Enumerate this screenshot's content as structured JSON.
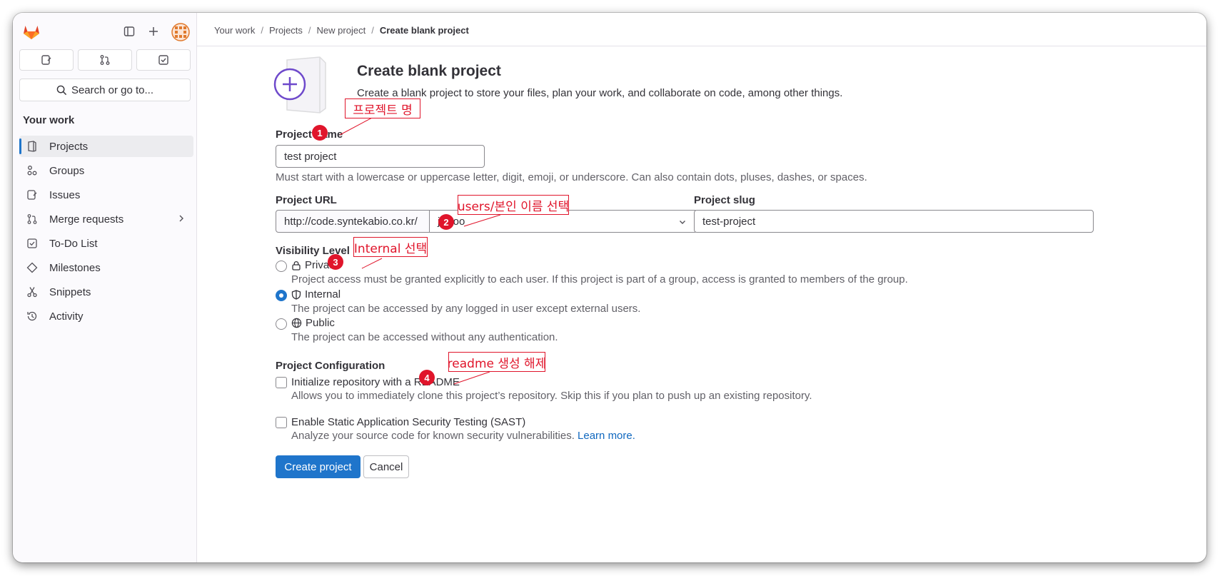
{
  "sidebar": {
    "section_title": "Your work",
    "search_label": "Search or go to...",
    "quick_actions": [
      "issues-icon",
      "merge-request-icon",
      "todo-icon"
    ],
    "items": [
      {
        "label": "Projects",
        "icon": "project-icon",
        "active": true
      },
      {
        "label": "Groups",
        "icon": "group-icon"
      },
      {
        "label": "Issues",
        "icon": "issues-icon"
      },
      {
        "label": "Merge requests",
        "icon": "merge-request-icon",
        "has_chevron": true
      },
      {
        "label": "To-Do List",
        "icon": "todo-icon"
      },
      {
        "label": "Milestones",
        "icon": "milestone-icon"
      },
      {
        "label": "Snippets",
        "icon": "snippet-icon"
      },
      {
        "label": "Activity",
        "icon": "history-icon"
      }
    ]
  },
  "breadcrumb": [
    "Your work",
    "Projects",
    "New project",
    "Create blank project"
  ],
  "header": {
    "title": "Create blank project",
    "subtitle": "Create a blank project to store your files, plan your work, and collaborate on code, among other things."
  },
  "form": {
    "project_name_label": "Project name",
    "project_name_value": "test project",
    "project_name_help": "Must start with a lowercase or uppercase letter, digit, emoji, or underscore. Can also contain dots, pluses, dashes, or spaces.",
    "project_url_label": "Project URL",
    "url_prefix": "http://code.syntekabio.co.kr/",
    "namespace_value": "jwkoo",
    "slash": "/",
    "project_slug_label": "Project slug",
    "project_slug_value": "test-project",
    "visibility_label": "Visibility Level",
    "visibility_options": [
      {
        "label": "Private",
        "icon": "lock-icon",
        "help": "Project access must be granted explicitly to each user. If this project is part of a group, access is granted to members of the group.",
        "checked": false
      },
      {
        "label": "Internal",
        "icon": "shield-icon",
        "help": "The project can be accessed by any logged in user except external users.",
        "checked": true
      },
      {
        "label": "Public",
        "icon": "earth-icon",
        "help": "The project can be accessed without any authentication.",
        "checked": false
      }
    ],
    "config_label": "Project Configuration",
    "readme_label": "Initialize repository with a README",
    "readme_help": "Allows you to immediately clone this project’s repository. Skip this if you plan to push up an existing repository.",
    "sast_label": "Enable Static Application Security Testing (SAST)",
    "sast_help": "Analyze your source code for known security vulnerabilities.",
    "sast_link": "Learn more.",
    "create_button": "Create project",
    "cancel_button": "Cancel"
  },
  "annotations": [
    {
      "number": "1",
      "text": "프로젝트 명"
    },
    {
      "number": "2",
      "text": "users/본인 이름 선택"
    },
    {
      "number": "3",
      "text": "Internal 선택"
    },
    {
      "number": "4",
      "text": "readme 생성 해제"
    }
  ],
  "colors": {
    "accent": "#1f75cb",
    "annotation": "#e0152b",
    "link": "#1068bf"
  }
}
